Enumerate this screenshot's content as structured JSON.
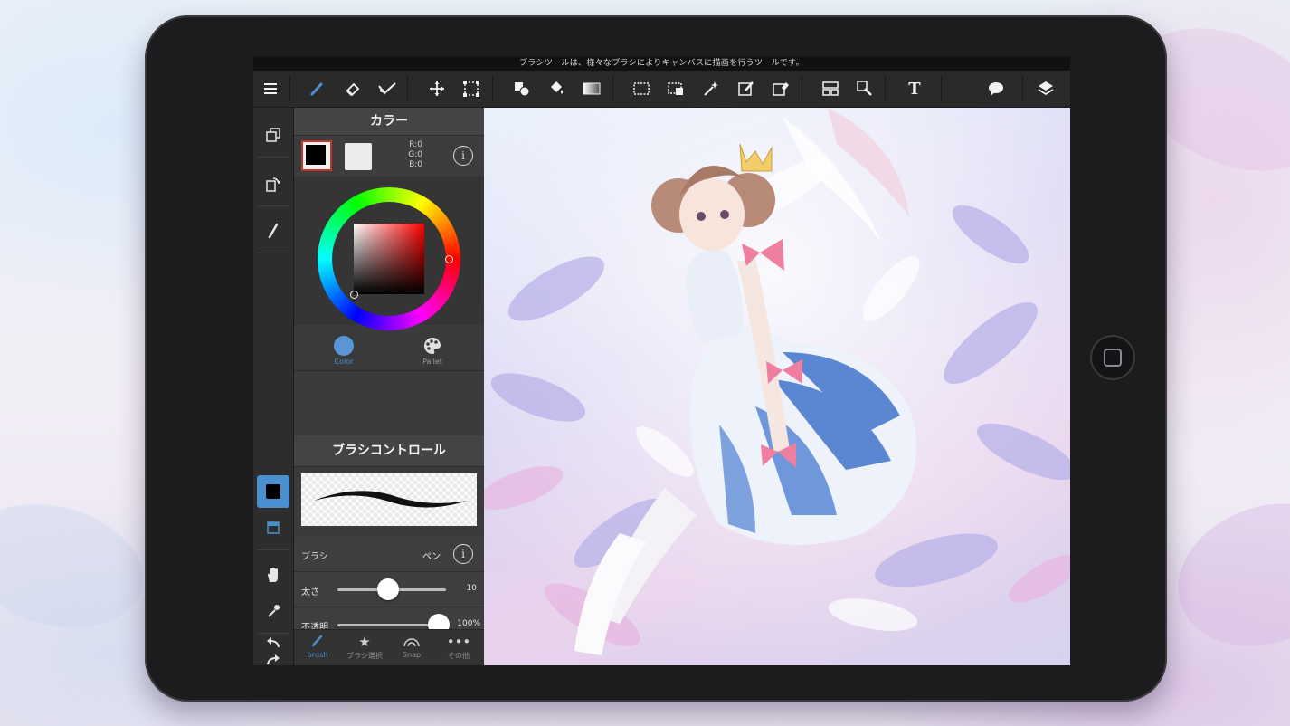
{
  "app": {
    "hint": "ブラシツールは、様々なブラシによりキャンバスに描画を行うツールです。"
  },
  "toolbar": {
    "icons": [
      "menu-icon",
      "brush-icon",
      "eraser-icon",
      "smudge-icon",
      "move-icon",
      "transform-icon",
      "fill-shape-icon",
      "bucket-icon",
      "gradient-icon",
      "select-rect-icon",
      "select-clear-icon",
      "magic-wand-icon",
      "select-pen-icon",
      "select-eraser-icon",
      "filter-icon",
      "zoom-select-icon",
      "text-icon",
      "comment-icon",
      "layers-icon"
    ],
    "text_tool_label": "T"
  },
  "color_panel": {
    "title": "カラー",
    "rgb": [
      "R:0",
      "G:0",
      "B:0"
    ],
    "info_label": "i",
    "foreground": "#000000",
    "secondary": "#ececec",
    "tabs": [
      {
        "label": "Color",
        "active": true
      },
      {
        "label": "Pallet",
        "active": false
      }
    ]
  },
  "brush_panel": {
    "title": "ブラシコントロール",
    "brush_label": "ブラシ",
    "brush_value": "ペン",
    "info_label": "i",
    "size_label": "太さ",
    "size_value": "10",
    "size_fraction": 0.47,
    "opacity_label": "不透明",
    "opacity_value": "100%",
    "opacity_fraction": 1.0
  },
  "bottom_tabs": [
    {
      "label": "brush",
      "icon": "brush-icon",
      "active": true
    },
    {
      "label": "ブラシ選択",
      "icon": "star-icon",
      "active": false
    },
    {
      "label": "Snap",
      "icon": "snap-icon",
      "active": false
    },
    {
      "label": "その他",
      "icon": "more-icon",
      "active": false
    }
  ],
  "accent": "#4a90d0"
}
